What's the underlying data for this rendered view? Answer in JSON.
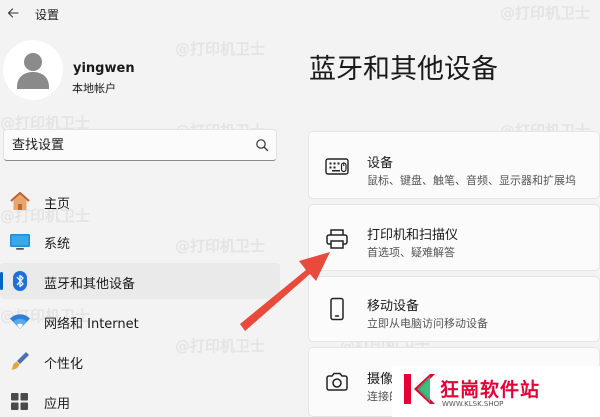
{
  "app": {
    "title": "设置",
    "back_icon": "arrow-left-icon"
  },
  "user": {
    "name": "yingwen",
    "account_type": "本地帐户"
  },
  "search": {
    "placeholder": "查找设置",
    "value": ""
  },
  "nav": {
    "items": [
      {
        "label": "主页",
        "icon": "home-icon",
        "active": false
      },
      {
        "label": "系统",
        "icon": "monitor-icon",
        "active": false
      },
      {
        "label": "蓝牙和其他设备",
        "icon": "bluetooth-icon",
        "active": true
      },
      {
        "label": "网络和 Internet",
        "icon": "wifi-icon",
        "active": false
      },
      {
        "label": "个性化",
        "icon": "paintbrush-icon",
        "active": false
      },
      {
        "label": "应用",
        "icon": "apps-icon",
        "active": false
      }
    ]
  },
  "page": {
    "title": "蓝牙和其他设备"
  },
  "cards": [
    {
      "title": "设备",
      "subtitle": "鼠标、键盘、触笔、音频、显示器和扩展坞",
      "icon": "keyboard-icon"
    },
    {
      "title": "打印机和扫描仪",
      "subtitle": "首选项、疑难解答",
      "icon": "printer-icon"
    },
    {
      "title": "移动设备",
      "subtitle": "立即从电脑访问移动设备",
      "icon": "phone-icon"
    },
    {
      "title": "摄像头",
      "subtitle": "连接的摄像头",
      "icon": "camera-icon"
    }
  ],
  "watermark": {
    "text": "@打印机卫士"
  },
  "logo": {
    "name": "狂崗软件站",
    "url": "WWW.KLSK.SHOP"
  },
  "colors": {
    "accent": "#0067c0",
    "arrow": "#e84a3c",
    "logo_red": "#e60033",
    "background": "#f3f3f3",
    "card": "#fbfbfb"
  }
}
